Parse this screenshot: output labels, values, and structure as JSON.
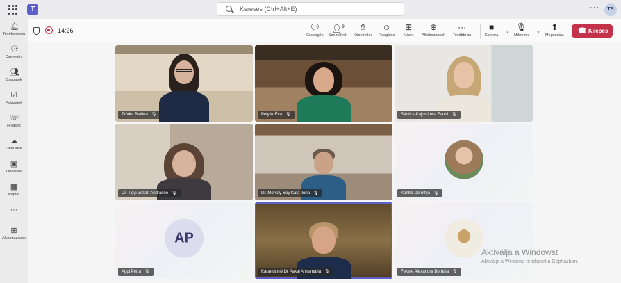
{
  "search": {
    "placeholder": "Keresés (Ctrl+Alt+E)"
  },
  "profile": {
    "initials": "TB"
  },
  "rail": [
    {
      "label": "Tevékenység",
      "icon": "bell-icon"
    },
    {
      "label": "Csevegés",
      "icon": "chat-icon"
    },
    {
      "label": "Csapatok",
      "icon": "teams-icon"
    },
    {
      "label": "Feladatok",
      "icon": "tasks-icon"
    },
    {
      "label": "Hívások",
      "icon": "phone-icon"
    },
    {
      "label": "OneDrive",
      "icon": "cloud-icon"
    },
    {
      "label": "OneNote",
      "icon": "onenote-icon"
    },
    {
      "label": "Naptár",
      "icon": "calendar-icon"
    },
    {
      "label": "Alkalmazások",
      "icon": "add-apps-icon"
    }
  ],
  "meeting": {
    "timer": "14:26",
    "people_count": "9",
    "tools": {
      "chat": "Csevegés",
      "people": "Személyek",
      "raise": "Kézemelés",
      "react": "Reagálás",
      "view": "Nézet",
      "apps": "Alkalmazások",
      "more": "További ak",
      "camera": "Kamera",
      "mic": "Mikrofon",
      "share": "Megosztás"
    },
    "leave": "Kilépés"
  },
  "participants": [
    {
      "name": "Tróder Bettina"
    },
    {
      "name": "Polyák Éva"
    },
    {
      "name": "Sántics-Kajos Luca Fanni"
    },
    {
      "name": "Dr. Tigyi Zoltán Andrásné"
    },
    {
      "name": "Dr. Morvay-Sey Kata Ilona"
    },
    {
      "name": "Kontra Dorottya"
    },
    {
      "name": "Appl Petra",
      "initials": "AP"
    },
    {
      "name": "Karamánné Dr Pakai Annamária"
    },
    {
      "name": "Fekete Alexandra Borbála"
    }
  ],
  "watermark": {
    "line1": "Aktiválja a Windowst",
    "line2": "Aktiválja a Windows rendszert a Gépházban."
  }
}
